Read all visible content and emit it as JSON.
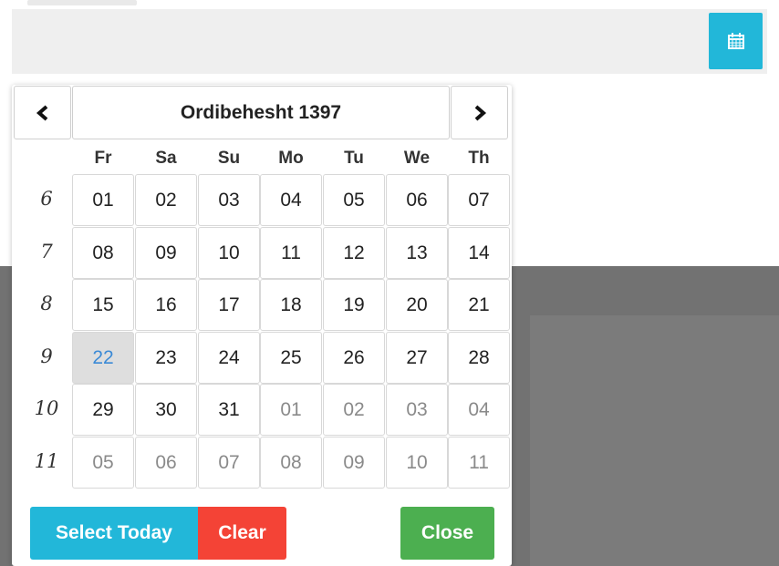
{
  "colors": {
    "accent_blue": "#22b7d9",
    "danger_red": "#f44336",
    "success_green": "#4caf50",
    "today_text": "#3b8ad6",
    "overlay": "#727272"
  },
  "calendar": {
    "month_title": "Ordibehesht 1397",
    "prev_icon": "chevron-left-icon",
    "next_icon": "chevron-right-icon",
    "weekdays": [
      "Fr",
      "Sa",
      "Su",
      "Mo",
      "Tu",
      "We",
      "Th"
    ],
    "weeks": [
      {
        "num": "6",
        "days": [
          {
            "d": "01"
          },
          {
            "d": "02"
          },
          {
            "d": "03"
          },
          {
            "d": "04"
          },
          {
            "d": "05"
          },
          {
            "d": "06"
          },
          {
            "d": "07"
          }
        ]
      },
      {
        "num": "7",
        "days": [
          {
            "d": "08"
          },
          {
            "d": "09"
          },
          {
            "d": "10"
          },
          {
            "d": "11"
          },
          {
            "d": "12"
          },
          {
            "d": "13"
          },
          {
            "d": "14"
          }
        ]
      },
      {
        "num": "8",
        "days": [
          {
            "d": "15"
          },
          {
            "d": "16"
          },
          {
            "d": "17"
          },
          {
            "d": "18"
          },
          {
            "d": "19"
          },
          {
            "d": "20"
          },
          {
            "d": "21"
          }
        ]
      },
      {
        "num": "9",
        "days": [
          {
            "d": "22",
            "today": true
          },
          {
            "d": "23"
          },
          {
            "d": "24"
          },
          {
            "d": "25"
          },
          {
            "d": "26"
          },
          {
            "d": "27"
          },
          {
            "d": "28"
          }
        ]
      },
      {
        "num": "10",
        "days": [
          {
            "d": "29"
          },
          {
            "d": "30"
          },
          {
            "d": "31"
          },
          {
            "d": "01",
            "muted": true
          },
          {
            "d": "02",
            "muted": true
          },
          {
            "d": "03",
            "muted": true
          },
          {
            "d": "04",
            "muted": true
          }
        ]
      },
      {
        "num": "11",
        "days": [
          {
            "d": "05",
            "muted": true
          },
          {
            "d": "06",
            "muted": true
          },
          {
            "d": "07",
            "muted": true
          },
          {
            "d": "08",
            "muted": true
          },
          {
            "d": "09",
            "muted": true
          },
          {
            "d": "10",
            "muted": true
          },
          {
            "d": "11",
            "muted": true
          }
        ]
      }
    ]
  },
  "buttons": {
    "select_today": "Select Today",
    "clear": "Clear",
    "close": "Close"
  },
  "input": {
    "calendar_icon": "calendar-icon"
  }
}
